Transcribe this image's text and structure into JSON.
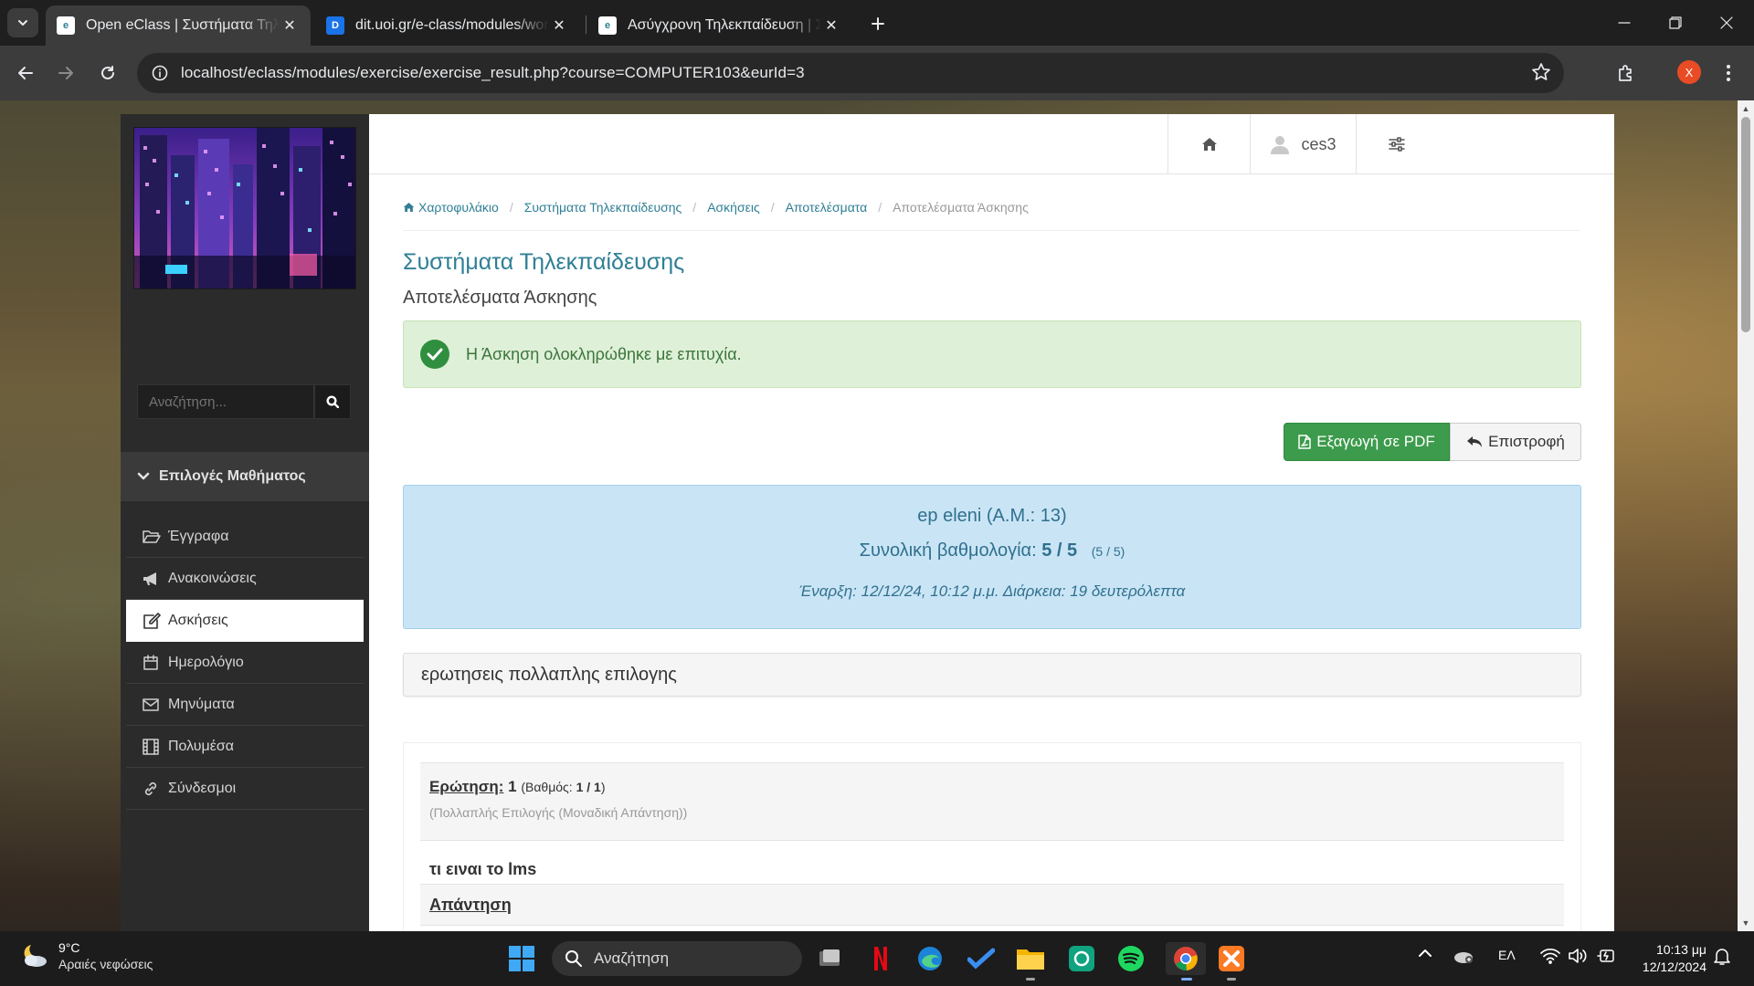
{
  "browser": {
    "tabs": [
      {
        "title": "Open eClass | Συστήματα Τηλεκπαίδευσης",
        "favicon": "eclass-icon"
      },
      {
        "title": "dit.uoi.gr/e-class/modules/work",
        "favicon": "docs-icon"
      },
      {
        "title": "Ασύγχρονη Τηλεκπαίδευση | Συστήματα",
        "favicon": "eclass-icon"
      }
    ],
    "url": "localhost/eclass/modules/exercise/exercise_result.php?course=COMPUTER103&eurId=3",
    "profile_initial": "X"
  },
  "sidebar": {
    "search_placeholder": "Αναζήτηση...",
    "menu_title": "Επιλογές Μαθήματος",
    "items": [
      {
        "label": "Έγγραφα",
        "icon": "folder-open-icon"
      },
      {
        "label": "Ανακοινώσεις",
        "icon": "bullhorn-icon"
      },
      {
        "label": "Ασκήσεις",
        "icon": "edit-icon",
        "active": true
      },
      {
        "label": "Ημερολόγιο",
        "icon": "calendar-icon"
      },
      {
        "label": "Μηνύματα",
        "icon": "envelope-icon"
      },
      {
        "label": "Πολυμέσα",
        "icon": "film-icon"
      },
      {
        "label": "Σύνδεσμοι",
        "icon": "link-icon"
      }
    ]
  },
  "topnav": {
    "username": "ces3"
  },
  "breadcrumb": [
    "Χαρτοφυλάκιο",
    "Συστήματα Τηλεκπαίδευσης",
    "Ασκήσεις",
    "Αποτελέσματα",
    "Αποτελέσματα Άσκησης"
  ],
  "page": {
    "course_title": "Συστήματα Τηλεκπαίδευσης",
    "subtitle": "Αποτελέσματα Άσκησης",
    "success_message": "Η Άσκηση ολοκληρώθηκε με επιτυχία.",
    "export_pdf_label": "Εξαγωγή σε PDF",
    "back_label": "Επιστροφή",
    "student": "ep eleni (Α.Μ.: 13)",
    "total_score_label": "Συνολική βαθμολογία:",
    "total_score": "5 / 5",
    "total_score_small": "(5 / 5)",
    "start_label": "Έναρξη:",
    "start_value": "12/12/24, 10:12 μ.μ.",
    "duration_label": "Διάρκεια:",
    "duration_value": "19 δευτερόλεπτα",
    "section_title": "ερωτησεις πολλαπλης επιλογης",
    "question": {
      "label": "Ερώτηση:",
      "number": "1",
      "grade_label": "(Βαθμός:",
      "grade_value": "1 / 1",
      "grade_close": ")",
      "type": "(Πολλαπλής Επιλογής (Μοναδική Απάντηση))",
      "text": "τι ειναι το lms",
      "answer_label": "Απάντηση"
    }
  },
  "taskbar": {
    "temperature": "9°C",
    "weather_desc": "Αραιές νεφώσεις",
    "search_placeholder": "Αναζήτηση",
    "language": "ΕΛ",
    "time": "10:13 μμ",
    "date": "12/12/2024"
  },
  "colors": {
    "link": "#2f7f95",
    "success_bg": "#dff0d8",
    "info_bg": "#c9e5f5",
    "pdf_button": "#3c9b4c",
    "sidebar_bg": "#2b2b2b"
  }
}
